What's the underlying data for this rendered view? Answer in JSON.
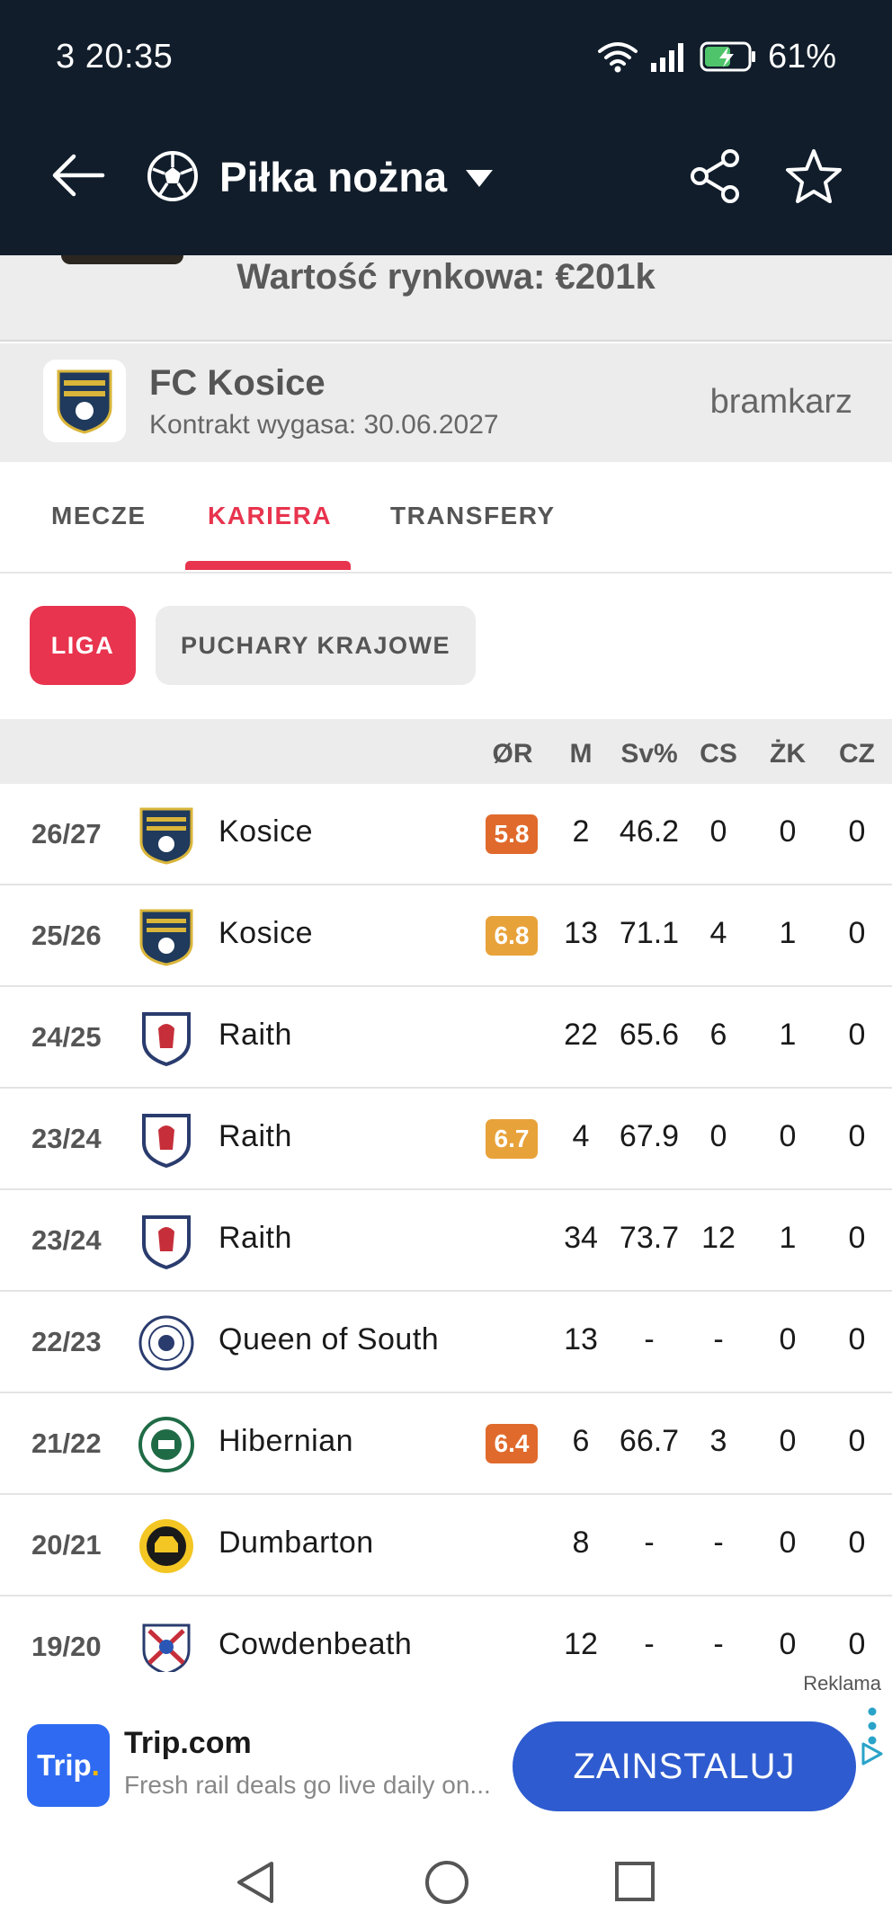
{
  "status": {
    "time": "3 20:35",
    "battery": "61%"
  },
  "appbar": {
    "title": "Piłka nożna"
  },
  "header": {
    "market_value": "Wartość rynkowa: €201k"
  },
  "club": {
    "name": "FC Kosice",
    "contract": "Kontrakt wygasa: 30.06.2027",
    "position": "bramkarz"
  },
  "tabs": [
    {
      "label": "MECZE",
      "active": false
    },
    {
      "label": "KARIERA",
      "active": true
    },
    {
      "label": "TRANSFERY",
      "active": false
    }
  ],
  "chips": [
    {
      "label": "LIGA",
      "active": true
    },
    {
      "label": "PUCHARY KRAJOWE",
      "active": false
    }
  ],
  "table": {
    "columns": [
      "ØR",
      "M",
      "Sv%",
      "CS",
      "ŻK",
      "CZ"
    ],
    "rows": [
      {
        "season": "26/27",
        "team": "Kosice",
        "logo": "kosice-logo",
        "rating": "5.8",
        "rating_color": "#e06a2c",
        "m": "2",
        "sv": "46.2",
        "cs": "0",
        "zk": "0",
        "cz": "0"
      },
      {
        "season": "25/26",
        "team": "Kosice",
        "logo": "kosice-logo",
        "rating": "6.8",
        "rating_color": "#e8a23a",
        "m": "13",
        "sv": "71.1",
        "cs": "4",
        "zk": "1",
        "cz": "0"
      },
      {
        "season": "24/25",
        "team": "Raith",
        "logo": "raith-logo",
        "rating": "",
        "rating_color": "",
        "m": "22",
        "sv": "65.6",
        "cs": "6",
        "zk": "1",
        "cz": "0"
      },
      {
        "season": "23/24",
        "team": "Raith",
        "logo": "raith-logo",
        "rating": "6.7",
        "rating_color": "#e8a23a",
        "m": "4",
        "sv": "67.9",
        "cs": "0",
        "zk": "0",
        "cz": "0"
      },
      {
        "season": "23/24",
        "team": "Raith",
        "logo": "raith-logo",
        "rating": "",
        "rating_color": "",
        "m": "34",
        "sv": "73.7",
        "cs": "12",
        "zk": "1",
        "cz": "0"
      },
      {
        "season": "22/23",
        "team": "Queen of South",
        "logo": "queen-of-south-logo",
        "rating": "",
        "rating_color": "",
        "m": "13",
        "sv": "-",
        "cs": "-",
        "zk": "0",
        "cz": "0"
      },
      {
        "season": "21/22",
        "team": "Hibernian",
        "logo": "hibernian-logo",
        "rating": "6.4",
        "rating_color": "#e06a2c",
        "m": "6",
        "sv": "66.7",
        "cs": "3",
        "zk": "0",
        "cz": "0"
      },
      {
        "season": "20/21",
        "team": "Dumbarton",
        "logo": "dumbarton-logo",
        "rating": "",
        "rating_color": "",
        "m": "8",
        "sv": "-",
        "cs": "-",
        "zk": "0",
        "cz": "0"
      },
      {
        "season": "19/20",
        "team": "Cowdenbeath",
        "logo": "cowdenbeath-logo",
        "rating": "",
        "rating_color": "",
        "m": "12",
        "sv": "-",
        "cs": "-",
        "zk": "0",
        "cz": "0"
      }
    ]
  },
  "ad": {
    "label": "Reklama",
    "logo_text": "Trip",
    "logo_dot": ".",
    "title": "Trip.com",
    "subtitle": "Fresh rail deals go live daily on...",
    "cta": "ZAINSTALUJ"
  },
  "colors": {
    "accent": "#e8344e",
    "appbar_bg": "#111d2b",
    "ad_button": "#2e5bcf"
  }
}
